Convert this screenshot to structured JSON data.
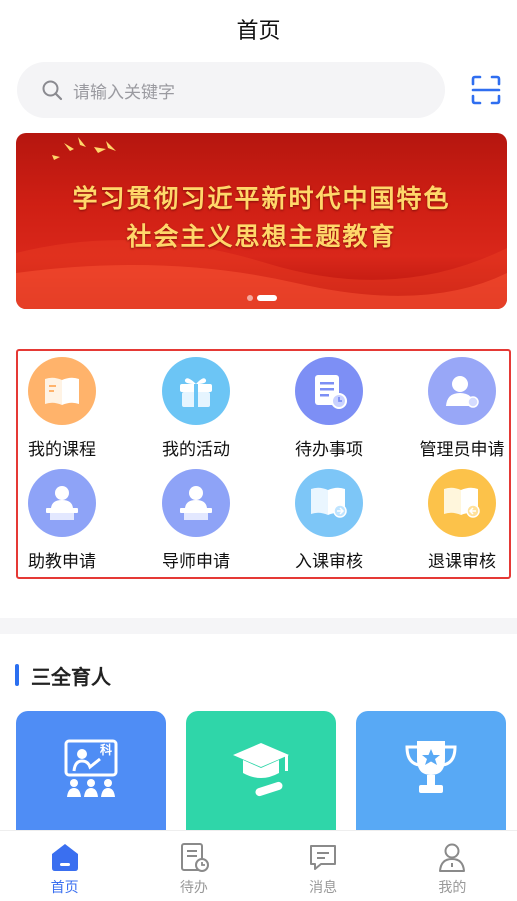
{
  "header": {
    "title": "首页"
  },
  "search": {
    "placeholder": "请输入关键字"
  },
  "banner": {
    "line1": "学习贯彻习近平新时代中国特色",
    "line2": "社会主义思想主题教育"
  },
  "grid": [
    {
      "label": "我的课程",
      "icon": "book-icon",
      "color": "#ffb36b"
    },
    {
      "label": "我的活动",
      "icon": "gift-icon",
      "color": "#6cc5f5"
    },
    {
      "label": "待办事项",
      "icon": "todo-list-icon",
      "color": "#7d8ff5"
    },
    {
      "label": "管理员申请",
      "icon": "admin-user-icon",
      "color": "#98a7f7"
    },
    {
      "label": "助教申请",
      "icon": "teacher-podium-icon",
      "color": "#8ea3f7"
    },
    {
      "label": "导师申请",
      "icon": "mentor-podium-icon",
      "color": "#8ea3f7"
    },
    {
      "label": "入课审核",
      "icon": "course-enter-review-icon",
      "color": "#7dc6f7"
    },
    {
      "label": "退课审核",
      "icon": "course-exit-review-icon",
      "color": "#fcc24a"
    }
  ],
  "section": {
    "title": "三全育人"
  },
  "cards": [
    {
      "icon": "classroom-icon",
      "badge": "科",
      "color": "#4f8df5"
    },
    {
      "icon": "graduation-cap-icon",
      "color": "#2fd6a9"
    },
    {
      "icon": "trophy-icon",
      "color": "#58a9f5"
    }
  ],
  "tabbar": [
    {
      "label": "首页",
      "icon": "home-icon",
      "active": true
    },
    {
      "label": "待办",
      "icon": "todo-icon",
      "active": false
    },
    {
      "label": "消息",
      "icon": "message-icon",
      "active": false
    },
    {
      "label": "我的",
      "icon": "profile-icon",
      "active": false
    }
  ],
  "colors": {
    "accent": "#3a6ff0",
    "highlight_border": "#e53935"
  }
}
